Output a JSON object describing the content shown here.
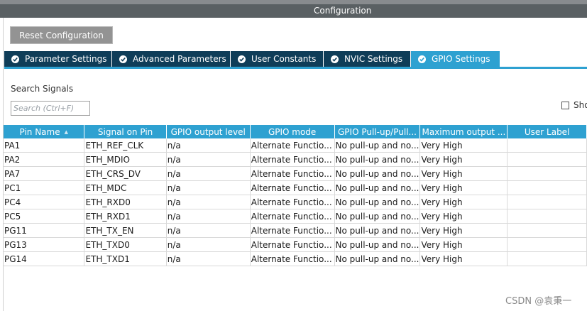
{
  "window": {
    "title": "Configuration"
  },
  "toolbar": {
    "reset_label": "Reset Configuration"
  },
  "tabs": [
    {
      "label": "Parameter Settings",
      "active": false
    },
    {
      "label": "Advanced Parameters",
      "active": false
    },
    {
      "label": "User Constants",
      "active": false
    },
    {
      "label": "NVIC Settings",
      "active": false
    },
    {
      "label": "GPIO Settings",
      "active": true
    }
  ],
  "search": {
    "label": "Search Signals",
    "placeholder": "Search (Ctrl+F)",
    "value": ""
  },
  "show_option": {
    "label": "Sho",
    "checked": false
  },
  "table": {
    "columns": [
      "Pin Name",
      "Signal on Pin",
      "GPIO output level",
      "GPIO mode",
      "GPIO Pull-up/Pull...",
      "Maximum output ...",
      "User Label"
    ],
    "rows": [
      [
        "PA1",
        "ETH_REF_CLK",
        "n/a",
        "Alternate Functio...",
        "No pull-up and no...",
        "Very High",
        ""
      ],
      [
        "PA2",
        "ETH_MDIO",
        "n/a",
        "Alternate Functio...",
        "No pull-up and no...",
        "Very High",
        ""
      ],
      [
        "PA7",
        "ETH_CRS_DV",
        "n/a",
        "Alternate Functio...",
        "No pull-up and no...",
        "Very High",
        ""
      ],
      [
        "PC1",
        "ETH_MDC",
        "n/a",
        "Alternate Functio...",
        "No pull-up and no...",
        "Very High",
        ""
      ],
      [
        "PC4",
        "ETH_RXD0",
        "n/a",
        "Alternate Functio...",
        "No pull-up and no...",
        "Very High",
        ""
      ],
      [
        "PC5",
        "ETH_RXD1",
        "n/a",
        "Alternate Functio...",
        "No pull-up and no...",
        "Very High",
        ""
      ],
      [
        "PG11",
        "ETH_TX_EN",
        "n/a",
        "Alternate Functio...",
        "No pull-up and no...",
        "Very High",
        ""
      ],
      [
        "PG13",
        "ETH_TXD0",
        "n/a",
        "Alternate Functio...",
        "No pull-up and no...",
        "Very High",
        ""
      ],
      [
        "PG14",
        "ETH_TXD1",
        "n/a",
        "Alternate Functio...",
        "No pull-up and no...",
        "Very High",
        ""
      ]
    ]
  },
  "watermark": "CSDN @袁秉一",
  "colors": {
    "accent": "#2ea1d1",
    "tab_dark": "#0f3d58",
    "titlebar": "#5a6063",
    "button": "#939393"
  }
}
